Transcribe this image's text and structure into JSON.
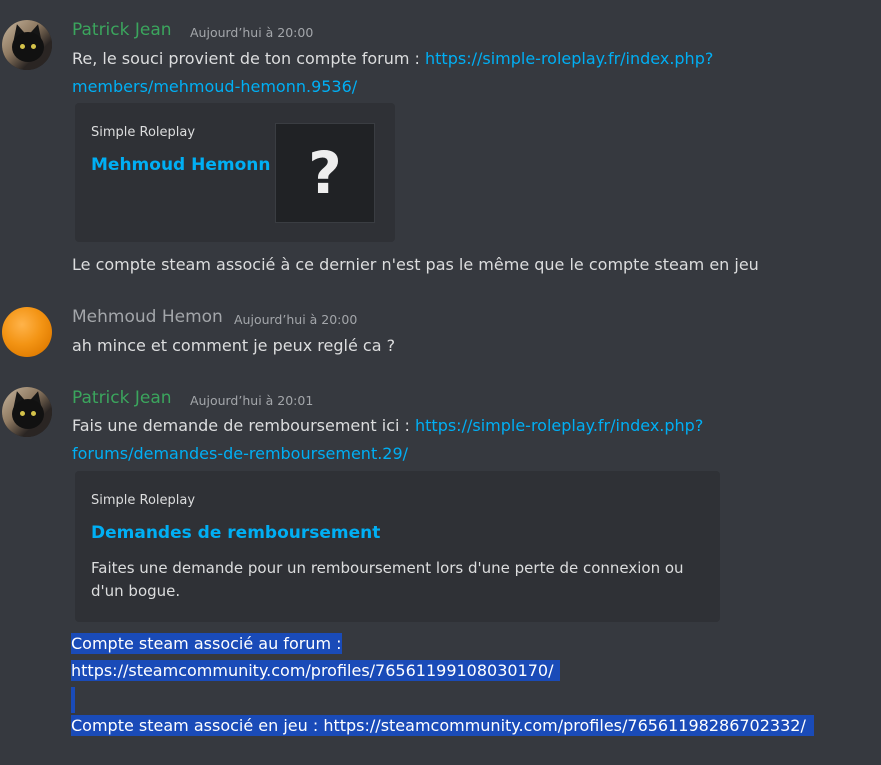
{
  "messages": [
    {
      "author": "Patrick Jean",
      "author_color": "#3ba55d",
      "timestamp": "Aujourd’hui à 20:00",
      "line1_prefix": "Re, le souci provient de ton compte forum : ",
      "link_part1": "https://simple-roleplay.fr/index.php?",
      "link_part2": "members/mehmoud-hemonn.9536/",
      "embed": {
        "provider": "Simple Roleplay",
        "title": "Mehmoud Hemonn",
        "thumbnail": "?"
      },
      "followup": "Le compte steam associé à ce dernier n'est pas le même que le compte steam en jeu"
    },
    {
      "author": "Mehmoud Hemon",
      "author_color": "#a3a6aa",
      "timestamp": "Aujourd’hui à 20:00",
      "text": "ah mince et comment je peux reglé ca ?"
    },
    {
      "author": "Patrick Jean",
      "author_color": "#3ba55d",
      "timestamp": "Aujourd’hui à 20:01",
      "line1_prefix": "Fais une demande de remboursement ici : ",
      "link_part1": "https://simple-roleplay.fr/index.php?",
      "link_part2": "forums/demandes-de-remboursement.29/",
      "embed": {
        "provider": "Simple Roleplay",
        "title": "Demandes de remboursement",
        "description_line1": "Faites une demande pour un remboursement lors d'une perte de connexion ou",
        "description_line2": "d'un bogue."
      },
      "selected_lines": [
        "Compte steam associé au forum : ",
        "https://steamcommunity.com/profiles/76561199108030170/",
        "",
        "Compte steam associé en jeu : https://steamcommunity.com/profiles/76561198286702332/"
      ]
    }
  ]
}
